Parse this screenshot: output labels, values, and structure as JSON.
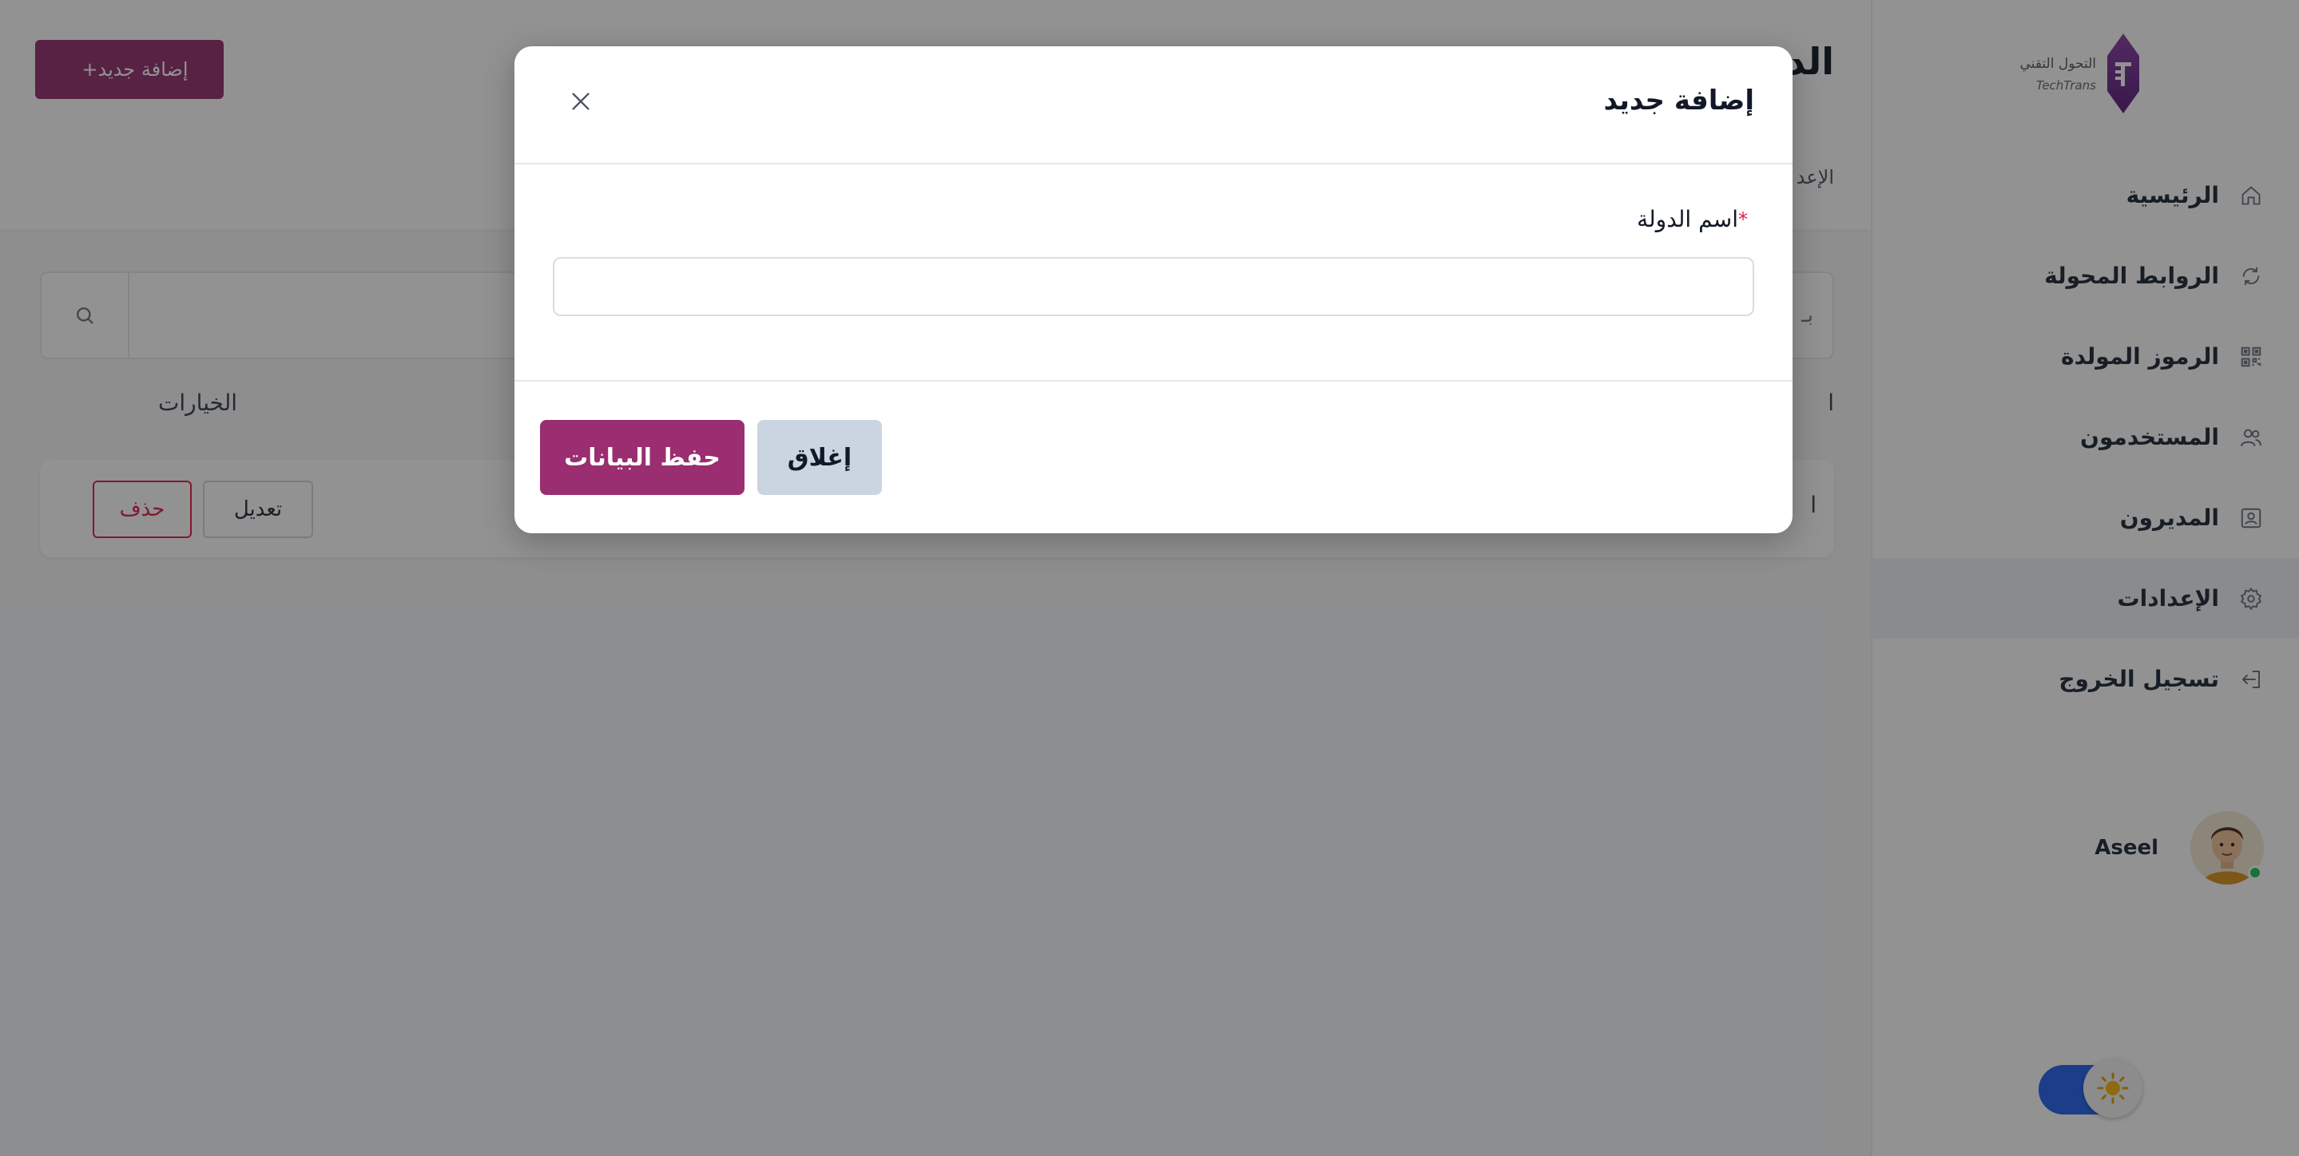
{
  "sidebar": {
    "logo": {
      "text_ar": "التحول التقني",
      "text_en": "TechTrans",
      "brand_color": "#7a2a8c"
    },
    "items": [
      {
        "label": "الرئيسية",
        "icon": "home-icon"
      },
      {
        "label": "الروابط المحولة",
        "icon": "refresh-icon"
      },
      {
        "label": "الرموز المولدة",
        "icon": "qr-code-icon"
      },
      {
        "label": "المستخدمون",
        "icon": "users-icon"
      },
      {
        "label": "المديرون",
        "icon": "admin-icon"
      },
      {
        "label": "الإعدادات",
        "icon": "gear-icon",
        "active": true
      },
      {
        "label": "تسجيل الخروج",
        "icon": "logout-icon"
      }
    ],
    "user": {
      "name": "Aseel",
      "status": "online"
    },
    "theme_toggle": {
      "icon": "sun-icon",
      "accent": "#2563eb"
    }
  },
  "main": {
    "add_button": {
      "label": "إضافة جديد",
      "icon": "+"
    },
    "page_title": "الد",
    "breadcrumb": "الإعد",
    "search": {
      "placeholder": "بـ",
      "icon": "search-icon"
    },
    "table": {
      "columns": {
        "options": "الخيارات",
        "name": "ا"
      },
      "rows": [
        {
          "name": "ا",
          "edit_label": "تعديل",
          "delete_label": "حذف"
        }
      ]
    }
  },
  "modal": {
    "title": "إضافة جديد",
    "field_label": "اسم الدولة",
    "required_mark": "*",
    "field_value": "",
    "save_label": "حفظ البيانات",
    "close_label": "إغلاق",
    "accent_color": "#9a2e70",
    "danger_color": "#e11d48"
  }
}
